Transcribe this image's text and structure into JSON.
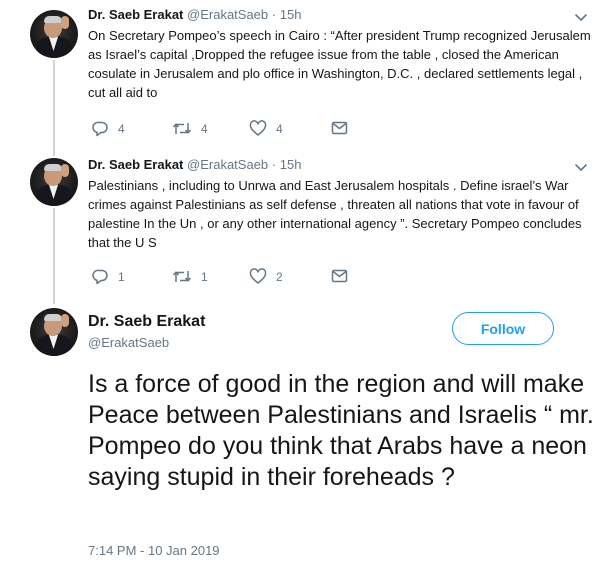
{
  "tweets": [
    {
      "name": "Dr. Saeb Erakat",
      "handle": "@ErakatSaeb",
      "dot": "·",
      "time": "15h",
      "text": "On Secretary Pompeo’s speech in Cairo : “After president Trump recognized Jerusalem as Israel’s capital ,Dropped the refugee issue from the table , closed the American cosulate in Jerusalem and plo office in Washington, D.C. , declared settlements legal , cut all aid to",
      "replies": "4",
      "retweets": "4",
      "likes": "4"
    },
    {
      "name": "Dr. Saeb Erakat",
      "handle": "@ErakatSaeb",
      "dot": "·",
      "time": "15h",
      "text": "Palestinians , including to Unrwa and East Jerusalem hospitals . Define israel’s War crimes against Palestinians as self defense , threaten all nations that vote in favour of palestine In the Un , or any other international agency ”. Secretary Pompeo concludes that the U S",
      "replies": "1",
      "retweets": "1",
      "likes": "2"
    }
  ],
  "main": {
    "name": "Dr. Saeb Erakat",
    "handle": "@ErakatSaeb",
    "follow_label": "Follow",
    "text": "Is a force of good in the region and will make Peace between Palestinians and Israelis “ mr. Pompeo do you think that Arabs have a neon saying stupid in their foreheads ?",
    "timestamp": "7:14 PM - 10 Jan 2019"
  },
  "colors": {
    "accent": "#1da1f2",
    "muted": "#657786",
    "text": "#14171a",
    "thread_line": "#ccd6dd"
  },
  "icons": [
    "avatar-photo",
    "chevron-down-icon",
    "reply-icon",
    "retweet-icon",
    "like-icon",
    "direct-message-icon"
  ]
}
